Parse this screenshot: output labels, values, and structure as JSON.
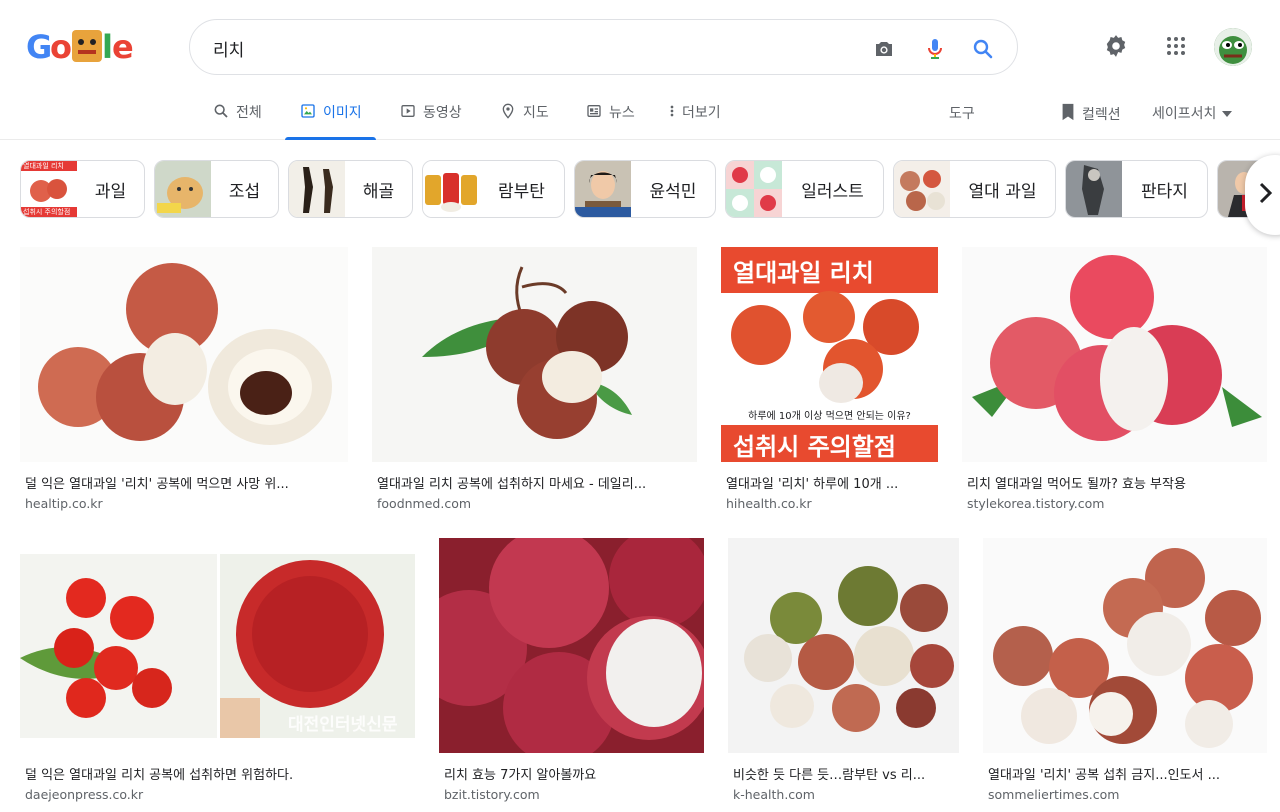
{
  "search": {
    "query": "리치"
  },
  "tabs": [
    {
      "label": "전체",
      "icon": "search-icon"
    },
    {
      "label": "이미지",
      "icon": "image-icon",
      "active": true
    },
    {
      "label": "동영상",
      "icon": "video-icon"
    },
    {
      "label": "지도",
      "icon": "location-pin-icon"
    },
    {
      "label": "뉴스",
      "icon": "news-icon"
    },
    {
      "label": "더보기",
      "icon": "more-vert-icon"
    }
  ],
  "tools": {
    "tools_label": "도구",
    "collections_label": "컬렉션",
    "safesearch_label": "세이프서치"
  },
  "chips": [
    {
      "label": "과일",
      "thumb_text_top": "열대과일 리치",
      "thumb_text_bottom": "섭취시 주의할점"
    },
    {
      "label": "조섭",
      "thumb_text_top": "",
      "thumb_text_bottom": ""
    },
    {
      "label": "해골",
      "thumb_text_top": "",
      "thumb_text_bottom": ""
    },
    {
      "label": "람부탄",
      "thumb_text_top": "",
      "thumb_text_bottom": ""
    },
    {
      "label": "윤석민",
      "thumb_text_top": "",
      "thumb_text_bottom": ""
    },
    {
      "label": "일러스트",
      "thumb_text_top": "",
      "thumb_text_bottom": ""
    },
    {
      "label": "열대 과일",
      "thumb_text_top": "",
      "thumb_text_bottom": ""
    },
    {
      "label": "판타지",
      "thumb_text_top": "",
      "thumb_text_bottom": ""
    }
  ],
  "results": [
    {
      "title": "덜 익은 열대과일 '리치' 공복에 먹으면 사망 위...",
      "source": "healtip.co.kr"
    },
    {
      "title": "열대과일 리치 공복에 섭취하지 마세요 - 데일리...",
      "source": "foodnmed.com"
    },
    {
      "title": "열대과일 '리치' 하루에 10개 ...",
      "source": "hihealth.co.kr",
      "overlay_top": "열대과일 리치",
      "overlay_mid": "하루에 10개 이상 먹으면 안되는 이유?",
      "overlay_bottom": "섭취시 주의할점"
    },
    {
      "title": "리치 열대과일 먹어도 될까? 효능 부작용",
      "source": "stylekorea.tistory.com"
    },
    {
      "title": "덜 익은 열대과일 리치 공복에 섭취하면 위험하다.",
      "source": "daejeonpress.co.kr",
      "watermark": "대전인터넷신문"
    },
    {
      "title": "리치 효능 7가지 알아볼까요",
      "source": "bzit.tistory.com"
    },
    {
      "title": "비슷한 듯 다른 듯…람부탄 vs 리...",
      "source": "k-health.com"
    },
    {
      "title": "열대과일 '리치' 공복 섭취 금지...인도서 ...",
      "source": "sommeliertimes.com"
    }
  ]
}
